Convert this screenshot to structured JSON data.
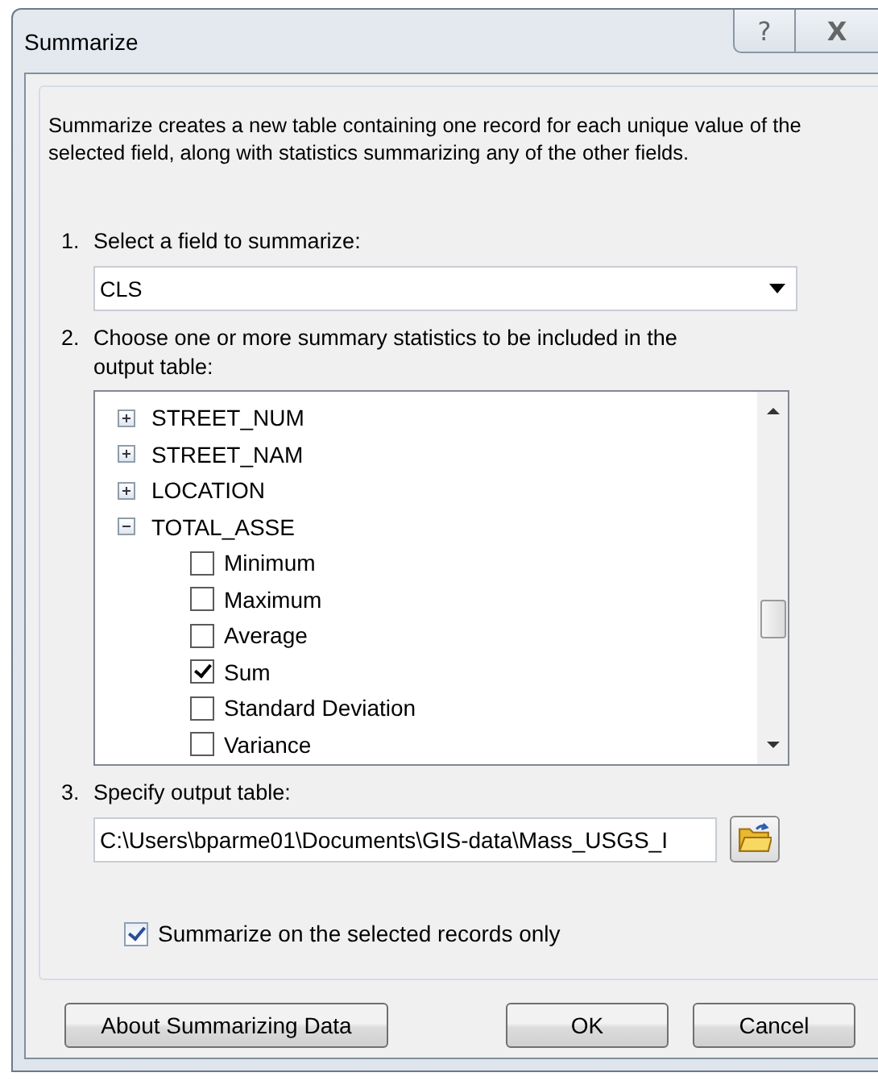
{
  "window": {
    "title": "Summarize",
    "help_button": "?",
    "close_button": "X"
  },
  "description": "Summarize creates a new table containing one record for each unique value of the selected field, along with statistics summarizing any of the other fields.",
  "step1": {
    "number": "1.",
    "label": "Select a field to summarize:",
    "value": "CLS"
  },
  "step2": {
    "number": "2.",
    "label": "Choose one or more summary statistics to be included in the output table:",
    "fields": [
      {
        "name": "STREET_NUM",
        "expanded": false
      },
      {
        "name": "STREET_NAM",
        "expanded": false
      },
      {
        "name": "LOCATION",
        "expanded": false
      },
      {
        "name": "TOTAL_ASSE",
        "expanded": true,
        "children": [
          {
            "name": "Minimum",
            "checked": false
          },
          {
            "name": "Maximum",
            "checked": false
          },
          {
            "name": "Average",
            "checked": false
          },
          {
            "name": "Sum",
            "checked": true
          },
          {
            "name": "Standard Deviation",
            "checked": false
          },
          {
            "name": "Variance",
            "checked": false
          }
        ]
      }
    ]
  },
  "step3": {
    "number": "3.",
    "label": "Specify output table:",
    "value": "C:\\Users\\bparme01\\Documents\\GIS-data\\Mass_USGS_I"
  },
  "selected_only": {
    "label": "Summarize on the selected records only",
    "checked": true
  },
  "buttons": [
    {
      "label": "About Summarizing Data",
      "kind": "help"
    },
    {
      "label": "OK",
      "kind": "action"
    },
    {
      "label": "Cancel",
      "kind": "action"
    }
  ]
}
